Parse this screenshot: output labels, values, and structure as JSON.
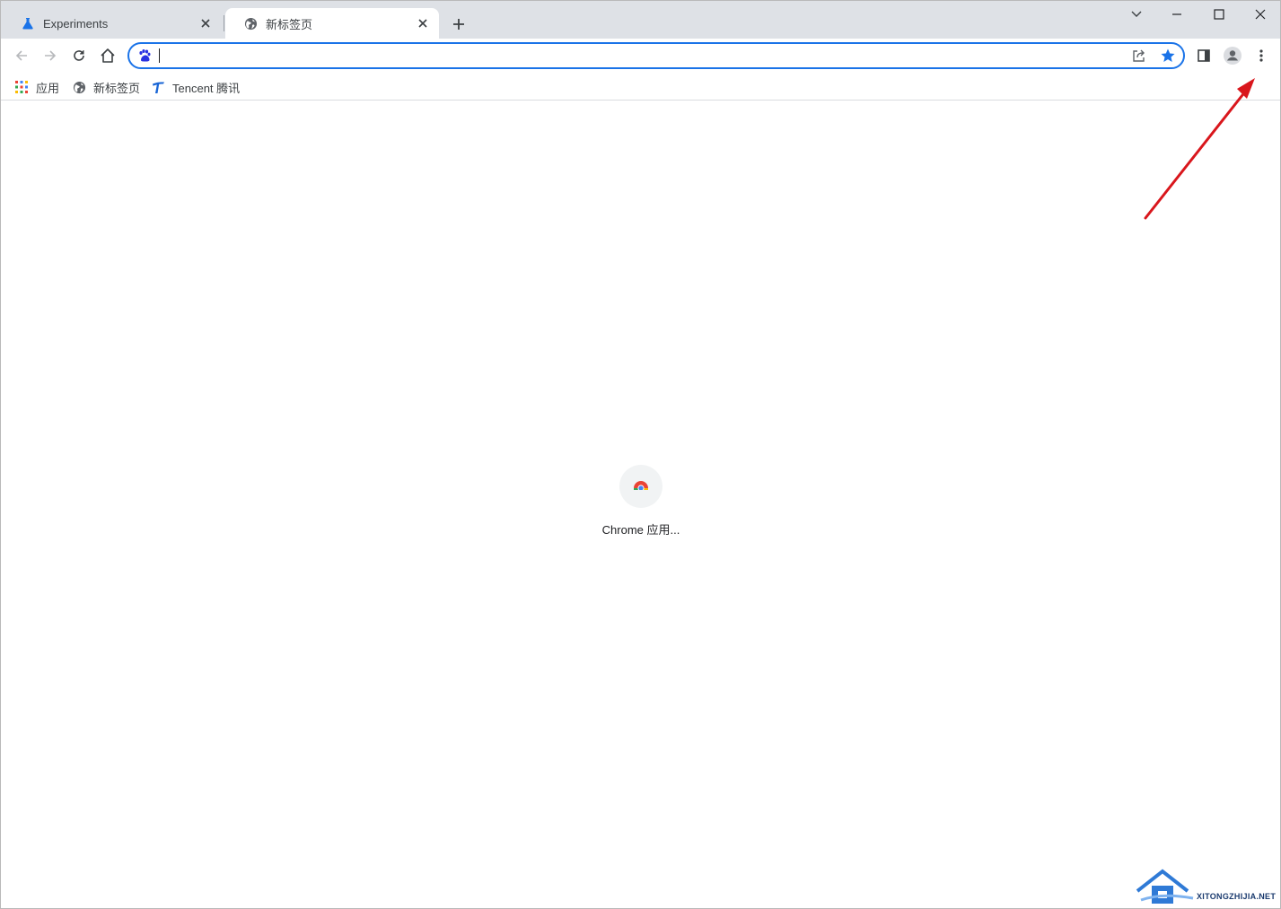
{
  "tabs": [
    {
      "title": "Experiments",
      "icon": "flask-icon",
      "active": false
    },
    {
      "title": "新标签页",
      "icon": "globe-icon",
      "active": true
    }
  ],
  "omnibox": {
    "value": "",
    "placeholder": "",
    "search_engine_icon": "baidu-paw-icon"
  },
  "bookmarks": [
    {
      "label": "应用",
      "icon": "apps-grid-icon"
    },
    {
      "label": "新标签页",
      "icon": "globe-icon"
    },
    {
      "label": "Tencent 腾讯",
      "icon": "tencent-icon"
    }
  ],
  "shortcut": {
    "label": "Chrome 应用...",
    "icon": "chrome-icon"
  },
  "watermark": {
    "text": "XITONGZHIJIA.NET"
  },
  "colors": {
    "accent": "#1a73e8",
    "tabstrip": "#dee1e6",
    "annotation_arrow": "#d9161c"
  }
}
